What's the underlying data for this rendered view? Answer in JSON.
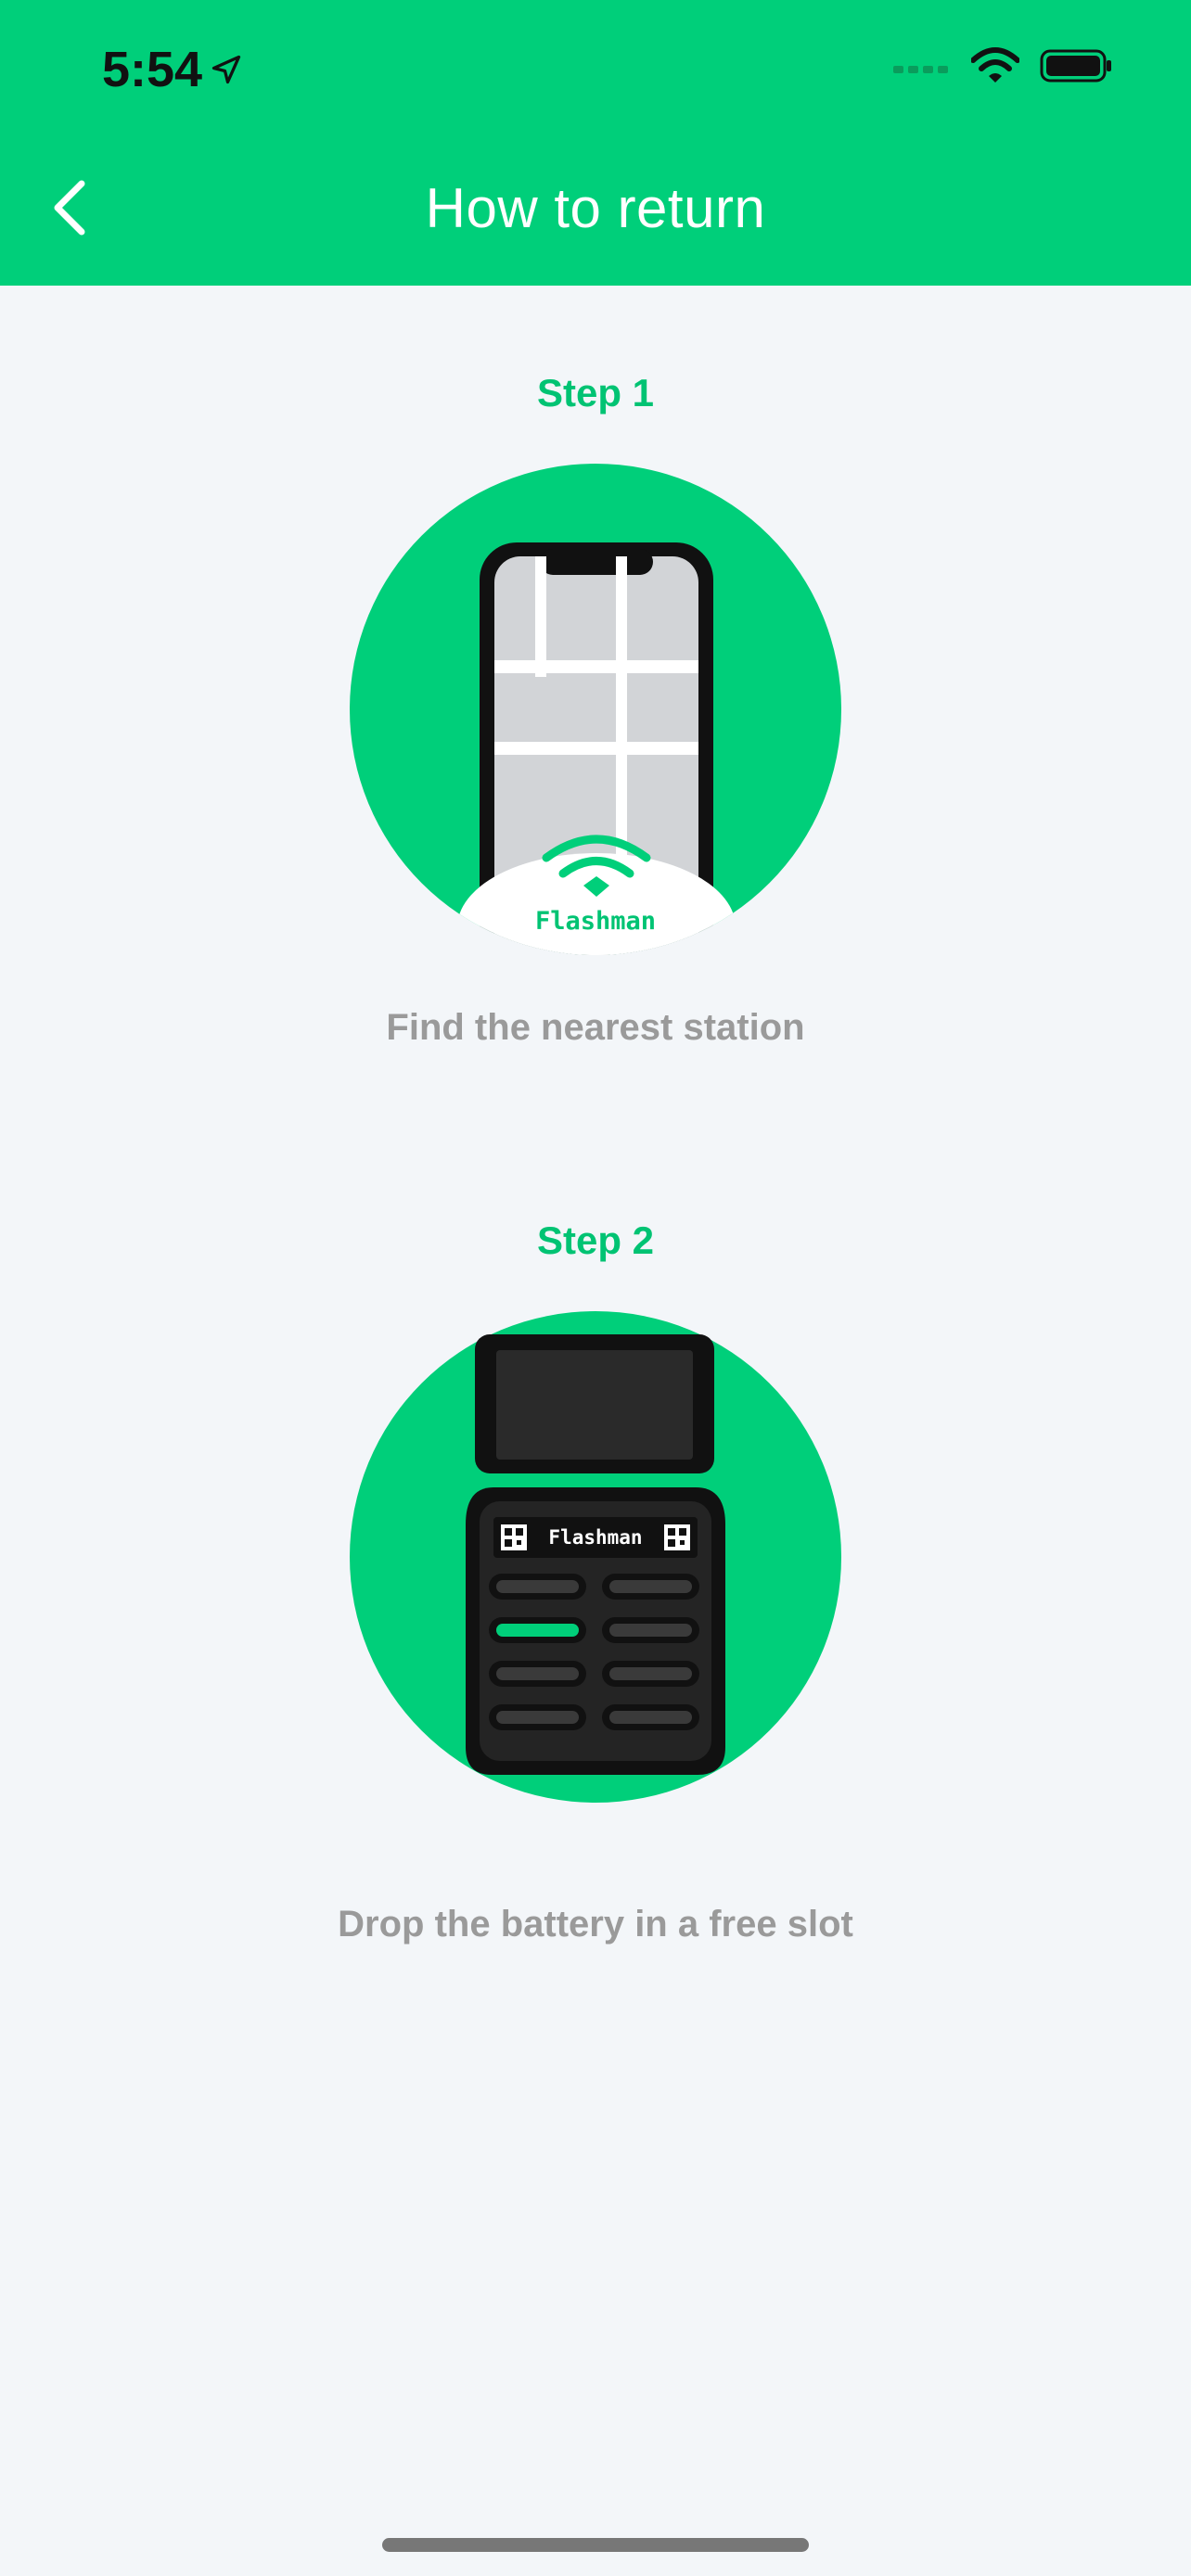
{
  "status": {
    "time": "5:54",
    "icons": [
      "location-arrow-icon",
      "signal-icon",
      "wifi-icon",
      "battery-icon"
    ]
  },
  "header": {
    "title": "How to return",
    "back_icon": "chevron-left-icon",
    "background": "#00cf7a"
  },
  "steps": [
    {
      "label": "Step 1",
      "caption": "Find the nearest station",
      "illustration": "phone-map-icon",
      "brand": "Flashman"
    },
    {
      "label": "Step 2",
      "caption": "Drop the battery in a free slot",
      "illustration": "charging-station-icon",
      "brand": "Flashman"
    }
  ],
  "colors": {
    "accent": "#00cf7a",
    "step_title": "#00c373",
    "caption": "#9a9a9a",
    "page_bg": "#f3f6f9"
  }
}
